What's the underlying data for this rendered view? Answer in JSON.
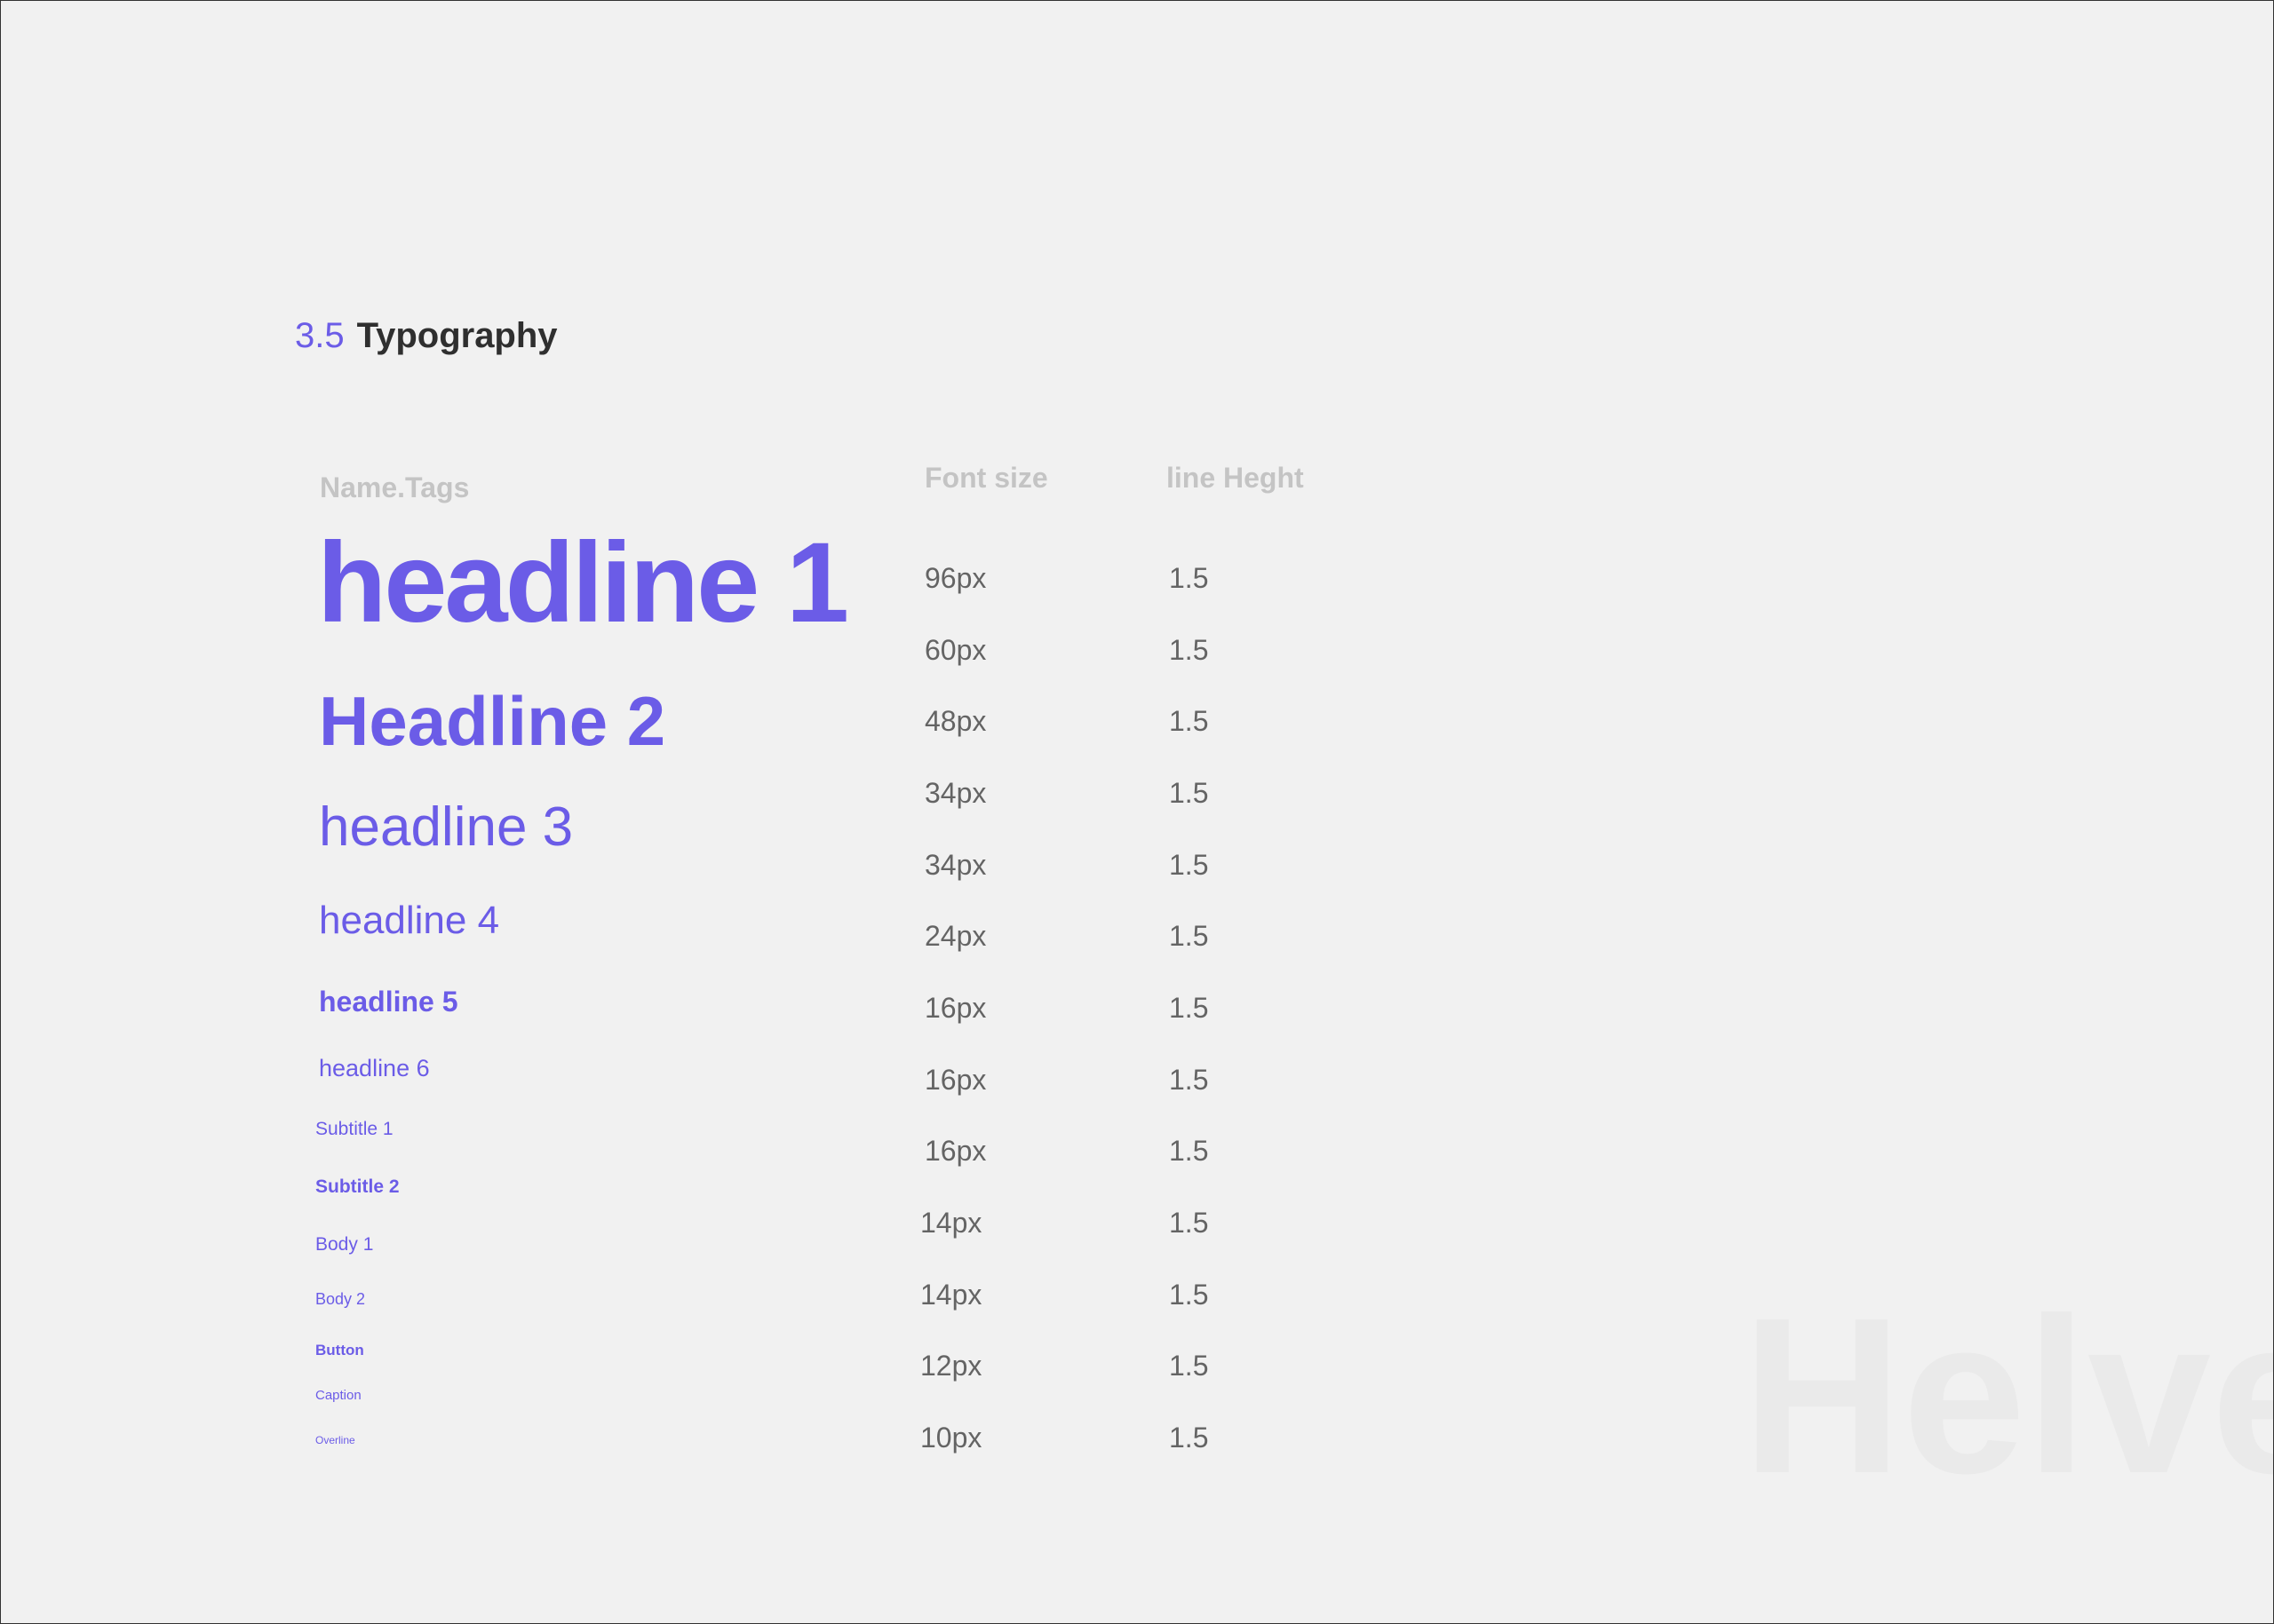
{
  "section": {
    "number": "3.5",
    "title": "Typography"
  },
  "table": {
    "headers": {
      "name": "Name.Tags",
      "font_size": "Font size",
      "line_height": "line Heght"
    },
    "rows": [
      {
        "name": "headline 1",
        "font_size": "96px",
        "line_height": "1.5"
      },
      {
        "name": "",
        "font_size": "60px",
        "line_height": "1.5"
      },
      {
        "name": "Headline 2",
        "font_size": "48px",
        "line_height": "1.5"
      },
      {
        "name": "headline 3",
        "font_size": "34px",
        "line_height": "1.5"
      },
      {
        "name": "headline 4",
        "font_size": "34px",
        "line_height": "1.5"
      },
      {
        "name": "headline 5",
        "font_size": "24px",
        "line_height": "1.5"
      },
      {
        "name": "headline 6",
        "font_size": "16px",
        "line_height": "1.5"
      },
      {
        "name": "Subtitle 1",
        "font_size": "16px",
        "line_height": "1.5"
      },
      {
        "name": "Subtitle 2",
        "font_size": "16px",
        "line_height": "1.5"
      },
      {
        "name": "Body 1",
        "font_size": "14px",
        "line_height": "1.5"
      },
      {
        "name": "Body 2",
        "font_size": "14px",
        "line_height": "1.5"
      },
      {
        "name": "Button",
        "font_size": "12px",
        "line_height": "1.5"
      },
      {
        "name": "Caption",
        "font_size": "10px",
        "line_height": "1.5"
      },
      {
        "name": "Overline",
        "font_size": "",
        "line_height": ""
      }
    ]
  },
  "watermark": "Helve",
  "colors": {
    "accent": "#6b5ce7",
    "title_text": "#2f2f2f",
    "header_text": "#c4c4c4",
    "value_text": "#646464",
    "background": "#f1f1f1",
    "watermark": "#eaeaea"
  }
}
